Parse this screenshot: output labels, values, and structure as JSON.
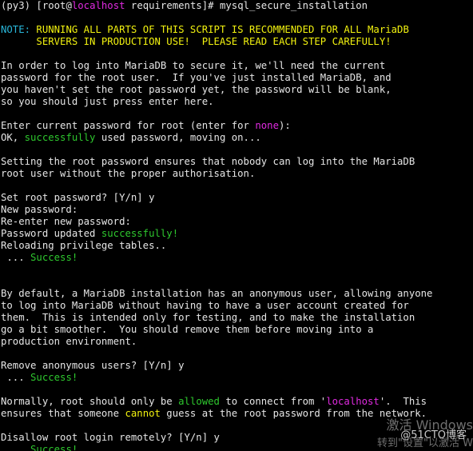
{
  "terminal": {
    "prompt": {
      "env": "(py3)",
      "open": " [",
      "user": "root",
      "at": "@",
      "host": "localhost",
      "path": " requirements]",
      "symbol": "# ",
      "command": "mysql_secure_installation"
    },
    "note": {
      "label": "NOTE:",
      "line1": " RUNNING ALL PARTS OF THIS SCRIPT IS RECOMMENDED FOR ALL MariaDB",
      "line2": "      SERVERS IN PRODUCTION USE!  PLEASE READ EACH STEP CAREFULLY!"
    },
    "intro": [
      "In order to log into MariaDB to secure it, we'll need the current",
      "password for the root user.  If you've just installed MariaDB, and",
      "you haven't set the root password yet, the password will be blank,",
      "so you should just press enter here."
    ],
    "enter_current": {
      "prefix": "Enter current password for root (enter for ",
      "none": "none",
      "suffix": "):"
    },
    "ok_line": {
      "prefix": "OK, ",
      "successfully": "successfully",
      "suffix": " used password, moving on..."
    },
    "setting_root": [
      "Setting the root password ensures that nobody can log into the MariaDB",
      "root user without the proper authorisation."
    ],
    "set_root_prompt": "Set root password? [Y/n] y",
    "new_password": "New password:",
    "reenter_password": "Re-enter new password:",
    "password_updated": {
      "prefix": "Password updated ",
      "successfully": "successfully!"
    },
    "reloading": "Reloading privilege tables..",
    "success_prefix": " ... ",
    "success_word": "Success!",
    "anonymous": [
      "By default, a MariaDB installation has an anonymous user, allowing anyone",
      "to log into MariaDB without having to have a user account created for",
      "them.  This is intended only for testing, and to make the installation",
      "go a bit smoother.  You should remove them before moving into a",
      "production environment."
    ],
    "remove_anon_prompt": "Remove anonymous users? [Y/n] y",
    "normally": {
      "p1": "Normally, root should only be ",
      "allowed": "allowed",
      "p2": " to connect from '",
      "localhost": "localhost",
      "p3": "'.  This",
      "l2_p1": "ensures that someone ",
      "cannot": "cannot",
      "l2_p2": " guess at the root password from the network."
    },
    "disallow_prompt": "Disallow root login remotely? [Y/n] y"
  },
  "watermark": {
    "activate": "激活 Windows",
    "goto": "转到\"设置\"以激活 W",
    "site": "@51CTO博客"
  },
  "colors": {
    "background": "#000000",
    "text": "#e6e6e6",
    "note_cyan": "#29b8db",
    "keyword_yellow": "#f2f20f",
    "success_green": "#2ec82e",
    "none_magenta": "#e02ae0"
  }
}
